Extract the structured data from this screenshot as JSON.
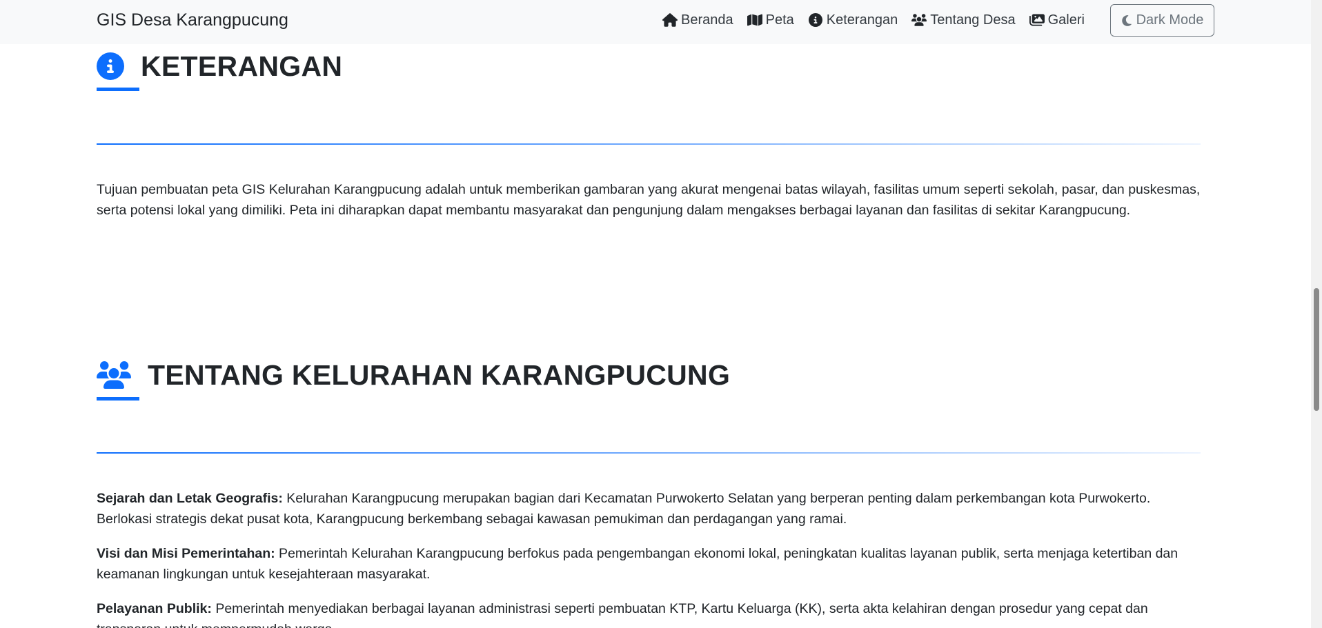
{
  "navbar": {
    "brand": "GIS Desa Karangpucung",
    "links": [
      {
        "label": "Beranda",
        "icon": "home-icon"
      },
      {
        "label": "Peta",
        "icon": "map-icon"
      },
      {
        "label": "Keterangan",
        "icon": "info-circle-icon"
      },
      {
        "label": "Tentang Desa",
        "icon": "users-icon"
      },
      {
        "label": "Galeri",
        "icon": "images-icon"
      }
    ],
    "dark_mode_label": "Dark Mode"
  },
  "keterangan": {
    "title": "KETERANGAN",
    "icon": "info-circle-icon",
    "text": "Tujuan pembuatan peta GIS Kelurahan Karangpucung adalah untuk memberikan gambaran yang akurat mengenai batas wilayah, fasilitas umum seperti sekolah, pasar, dan puskesmas, serta potensi lokal yang dimiliki. Peta ini diharapkan dapat membantu masyarakat dan pengunjung dalam mengakses berbagai layanan dan fasilitas di sekitar Karangpucung."
  },
  "tentang": {
    "title": "TENTANG KELURAHAN KARANGPUCUNG",
    "icon": "users-icon",
    "items": [
      {
        "label": "Sejarah dan Letak Geografis:",
        "text": " Kelurahan Karangpucung merupakan bagian dari Kecamatan Purwokerto Selatan yang berperan penting dalam perkembangan kota Purwokerto. Berlokasi strategis dekat pusat kota, Karangpucung berkembang sebagai kawasan pemukiman dan perdagangan yang ramai."
      },
      {
        "label": "Visi dan Misi Pemerintahan:",
        "text": " Pemerintah Kelurahan Karangpucung berfokus pada pengembangan ekonomi lokal, peningkatan kualitas layanan publik, serta menjaga ketertiban dan keamanan lingkungan untuk kesejahteraan masyarakat."
      },
      {
        "label": "Pelayanan Publik:",
        "text": " Pemerintah menyediakan berbagai layanan administrasi seperti pembuatan KTP, Kartu Keluarga (KK), serta akta kelahiran dengan prosedur yang cepat dan transparan untuk mempermudah warga."
      }
    ]
  },
  "colors": {
    "accent": "#0d6efd",
    "navbar_bg": "#f8f9fa",
    "text": "#212529",
    "muted": "#6c757d"
  }
}
